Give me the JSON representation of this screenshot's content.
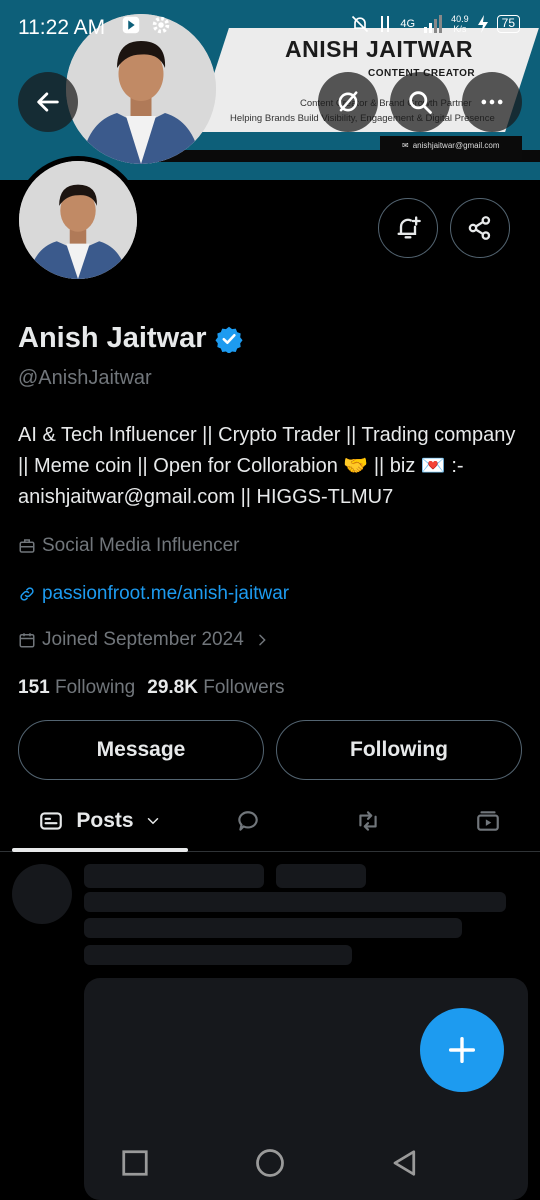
{
  "status_bar": {
    "time": "11:22 AM",
    "network": "4G",
    "speed_value": "40.9",
    "speed_unit": "K/s",
    "battery": "75"
  },
  "banner": {
    "name": "ANISH JAITWAR",
    "role": "CONTENT CREATOR",
    "tagline_1": "Content Creator & Brand Growth Partner",
    "tagline_2": "Helping Brands Build Visibility, Engagement & Digital Presence",
    "email": "anishjaitwar@gmail.com"
  },
  "profile": {
    "display_name": "Anish Jaitwar",
    "handle": "@AnishJaitwar",
    "bio": "AI & Tech Influencer || Crypto Trader || Trading company || Meme coin || Open for Collorabion 🤝 || biz 💌 :- anishjaitwar@gmail.com ||  HIGGS-TLMU7",
    "category": "Social Media Influencer",
    "website": "passionfroot.me/anish-jaitwar",
    "joined": "Joined September 2024"
  },
  "stats": {
    "following_count": "151",
    "following_label": "Following",
    "followers_count": "29.8K",
    "followers_label": "Followers"
  },
  "buttons": {
    "message": "Message",
    "following": "Following"
  },
  "tabs": {
    "posts": "Posts"
  },
  "colors": {
    "accent": "#1d9bf0",
    "background": "#000000",
    "muted": "#71767b",
    "banner": "#0d5f79"
  }
}
